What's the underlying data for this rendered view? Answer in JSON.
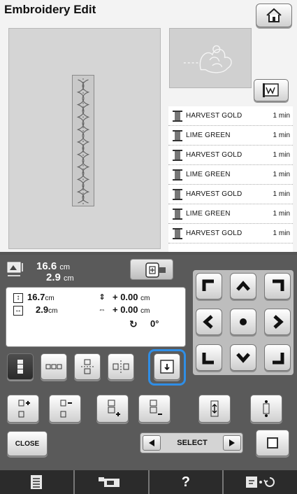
{
  "header": {
    "title": "Embroidery Edit"
  },
  "icons": {
    "home": "home-icon",
    "thread_swap": "thread-ww-icon"
  },
  "thread_colors": [
    {
      "name": "HARVEST GOLD",
      "time": "1 min"
    },
    {
      "name": "LIME GREEN",
      "time": "1 min"
    },
    {
      "name": "HARVEST GOLD",
      "time": "1 min"
    },
    {
      "name": "LIME GREEN",
      "time": "1 min"
    },
    {
      "name": "HARVEST GOLD",
      "time": "1 min"
    },
    {
      "name": "LIME GREEN",
      "time": "1 min"
    },
    {
      "name": "HARVEST GOLD",
      "time": "1 min"
    }
  ],
  "size": {
    "width_value": "16.6",
    "width_unit": "cm",
    "height_value": "2.9",
    "height_unit": "cm"
  },
  "info": {
    "vertical_value": "16.7",
    "vertical_unit": "cm",
    "horizontal_value": "2.9",
    "horizontal_unit": "cm",
    "offset_y_value": "+ 0.00",
    "offset_y_unit": "cm",
    "offset_x_value": "+ 0.00",
    "offset_x_unit": "cm",
    "rotation_value": "0°"
  },
  "controls": {
    "close_label": "CLOSE",
    "select_label": "SELECT"
  },
  "colors": {
    "highlight": "#2f8ee6",
    "panel": "#5a5a5a",
    "bottom_bar": "#2b2b2b"
  }
}
